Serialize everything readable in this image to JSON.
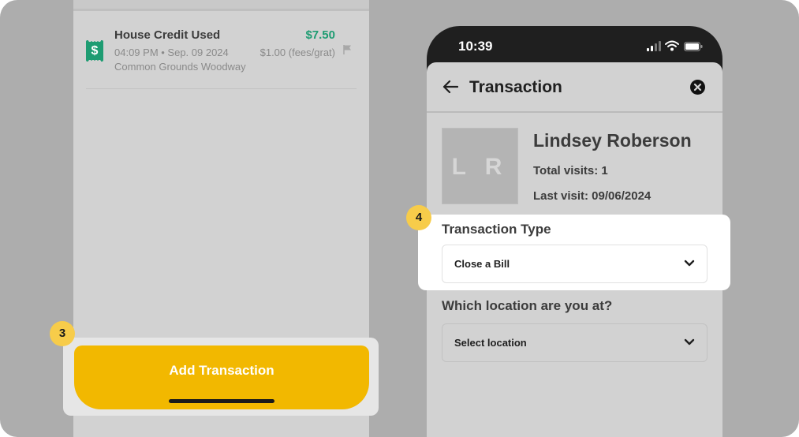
{
  "left_screen": {
    "transaction": {
      "title": "House Credit Used",
      "amount": "$7.50",
      "meta": "04:09 PM • Sep. 09 2024",
      "fees": "$1.00 (fees/grat)",
      "location": "Common Grounds Woodway",
      "icon": "receipt-dollar-icon"
    },
    "add_button_label": "Add Transaction"
  },
  "steps": {
    "three": "3",
    "four": "4"
  },
  "right_screen": {
    "status_bar": {
      "time": "10:39"
    },
    "header": {
      "title": "Transaction"
    },
    "customer": {
      "initials": "L R",
      "name": "Lindsey Roberson",
      "visits": "Total visits: 1",
      "last_visit": "Last visit: 09/06/2024"
    },
    "transaction_type": {
      "label": "Transaction Type",
      "value": "Close a Bill"
    },
    "location": {
      "label": "Which location are you at?",
      "value": "Select location"
    }
  },
  "colors": {
    "accent": "#f2b800",
    "positive": "#1e9c72",
    "badge": "#f7cc4a",
    "backdrop": "#adadad"
  }
}
